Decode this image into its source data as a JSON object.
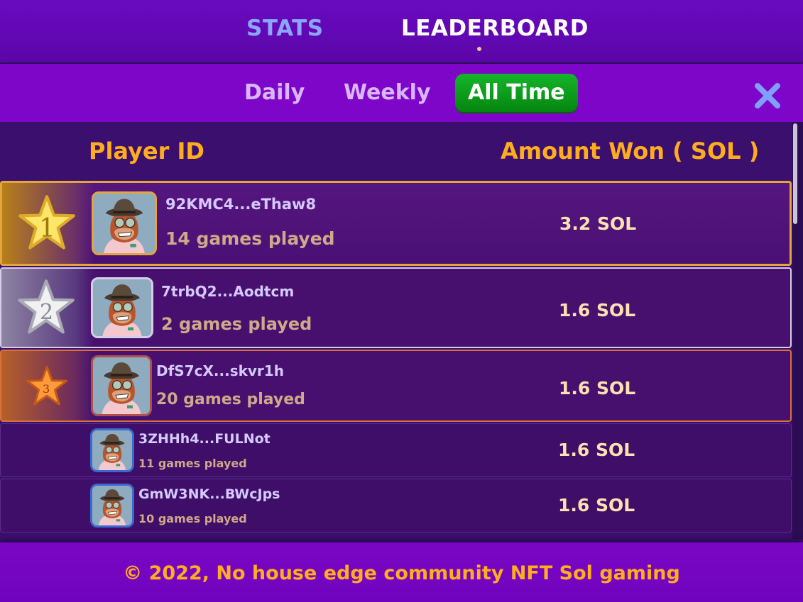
{
  "nav": {
    "tabs": [
      "STATS",
      "LEADERBOARD"
    ]
  },
  "filters": {
    "daily": "Daily",
    "weekly": "Weekly",
    "all_time": "All Time"
  },
  "table": {
    "col_player": "Player ID",
    "col_amount": "Amount Won ( SOL )"
  },
  "rows": [
    {
      "rank": "1",
      "player": "92KMC4...eThaw8",
      "games": "14 games played",
      "amount": "3.2 SOL"
    },
    {
      "rank": "2",
      "player": "7trbQ2...Aodtcm",
      "games": "2 games played",
      "amount": "1.6 SOL"
    },
    {
      "rank": "3",
      "player": "DfS7cX...skvr1h",
      "games": "20 games played",
      "amount": "1.6 SOL"
    },
    {
      "player": "3ZHHh4...FULNot",
      "games": "11 games played",
      "amount": "1.6 SOL"
    },
    {
      "player": "GmW3NK...BWcJps",
      "games": "10 games played",
      "amount": "1.6 SOL"
    }
  ],
  "footer": {
    "text": "© 2022, No house edge community NFT Sol gaming"
  },
  "colors": {
    "accent": "#ffad1f",
    "active_filter": "#0a9e1c",
    "gold": "#e4a53a",
    "silver": "#d7cde6",
    "bronze": "#d8723a"
  }
}
